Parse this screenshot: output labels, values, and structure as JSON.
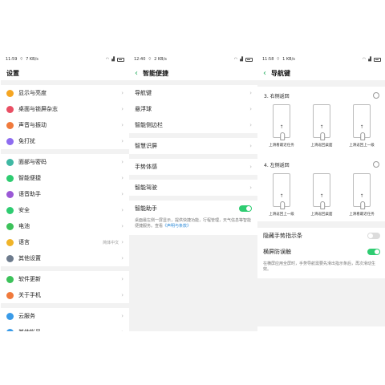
{
  "panel1": {
    "status": {
      "time": "11:59",
      "speed": "7 KB/s"
    },
    "title": "设置",
    "items": [
      {
        "label": "显示与亮度",
        "icon": "sun-icon",
        "color": "#f5a623"
      },
      {
        "label": "桌面与锁屏杂志",
        "icon": "palette-icon",
        "color": "#e94f64"
      },
      {
        "label": "声音与振动",
        "icon": "speaker-icon",
        "color": "#f07a3c"
      },
      {
        "label": "免打扰",
        "icon": "moon-icon",
        "color": "#8e6cf0"
      },
      {
        "label": "面部与密码",
        "icon": "face-icon",
        "color": "#3fb8a3"
      },
      {
        "label": "智能便捷",
        "icon": "smart-icon",
        "color": "#2ecc71"
      },
      {
        "label": "语音助手",
        "icon": "microphone-icon",
        "color": "#9b59d6"
      },
      {
        "label": "安全",
        "icon": "shield-icon",
        "color": "#2ecc71"
      },
      {
        "label": "电池",
        "icon": "battery-icon",
        "color": "#3cc25a"
      },
      {
        "label": "语言",
        "icon": "language-icon",
        "color": "#f0b429",
        "aux": "简体中文"
      },
      {
        "label": "其他设置",
        "icon": "gear-icon",
        "color": "#6d7b8d"
      },
      {
        "label": "软件更新",
        "icon": "update-icon",
        "color": "#3cc25a"
      },
      {
        "label": "关于手机",
        "icon": "info-icon",
        "color": "#f07a3c"
      },
      {
        "label": "云服务",
        "icon": "cloud-icon",
        "color": "#3a9be8"
      },
      {
        "label": "其他帐号",
        "icon": "account-icon",
        "color": "#3a9be8"
      }
    ]
  },
  "panel2": {
    "status": {
      "time": "12:40",
      "speed": "2 KB/s"
    },
    "title": "智能便捷",
    "items": [
      {
        "label": "导航键"
      },
      {
        "label": "悬浮球"
      },
      {
        "label": "智能侧边栏"
      },
      {
        "label": "智慧识屏"
      },
      {
        "label": "手势体感"
      },
      {
        "label": "智能驾驶"
      }
    ],
    "assistant": {
      "label": "智能助手",
      "toggle": "on",
      "desc": "桌面最左侧一屏显示，提供快捷功能，行程管理，天气信息等智能便捷服务。查看",
      "link": "《声明与条款》"
    }
  },
  "panel3": {
    "status": {
      "time": "11:58",
      "speed": "1 KB/s"
    },
    "title": "导航键",
    "option3": {
      "label": "3. 右侧返回",
      "captions": [
        "上滑看最近任务",
        "上滑返回桌面",
        "上滑返回上一级"
      ]
    },
    "option4": {
      "label": "4. 左侧返回",
      "captions": [
        "上滑返回上一级",
        "上滑返回桌面",
        "上滑看最近任务"
      ]
    },
    "hide_indicator": {
      "label": "隐藏手势指示条",
      "toggle": "off"
    },
    "landscape": {
      "label": "横屏防误触",
      "toggle": "on",
      "desc": "在横屏应用全屏时，手势导航需要先滑出指示条后，再次滑动生效。"
    }
  },
  "colors": {
    "accent": "#2ecc71",
    "link": "#2e8bd8",
    "divider": "#f2f2f2"
  }
}
